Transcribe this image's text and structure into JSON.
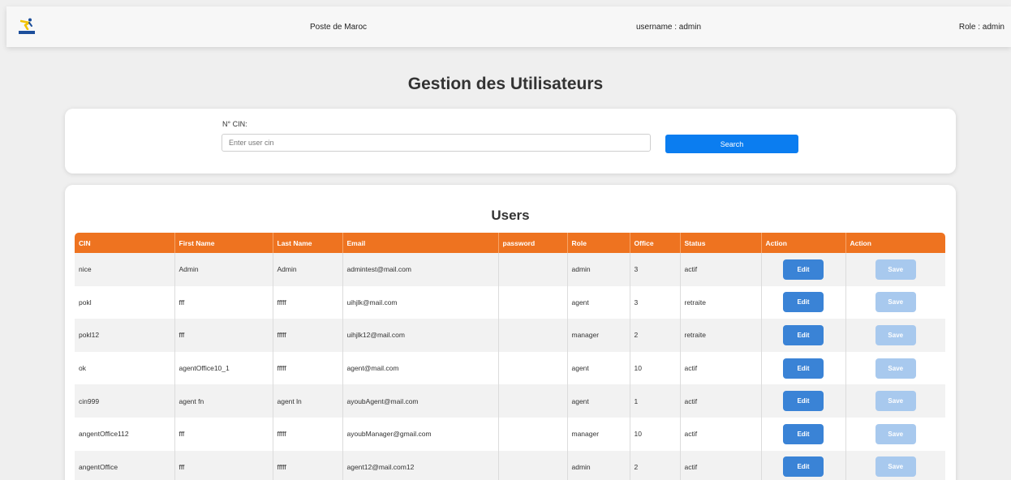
{
  "header": {
    "brand": "Poste de Maroc",
    "username": "username : admin",
    "role": "Role : admin"
  },
  "page": {
    "title": "Gestion des Utilisateurs"
  },
  "search": {
    "label": "N° CIN:",
    "placeholder": "Enter user cin",
    "value": "",
    "button_label": "Search"
  },
  "users": {
    "title": "Users",
    "columns": [
      "CIN",
      "First Name",
      "Last Name",
      "Email",
      "password",
      "Role",
      "Office",
      "Status",
      "Action",
      "Action"
    ],
    "edit_label": "Edit",
    "save_label": "Save",
    "rows": [
      {
        "cin": "nice",
        "first": "Admin",
        "last": "Admin",
        "email": "admintest@mail.com",
        "password": "",
        "role": "admin",
        "office": "3",
        "status": "actif"
      },
      {
        "cin": "pokl",
        "first": "fff",
        "last": "fffff",
        "email": "uihjlk@mail.com",
        "password": "",
        "role": "agent",
        "office": "3",
        "status": "retraite"
      },
      {
        "cin": "pokl12",
        "first": "fff",
        "last": "fffff",
        "email": "uihjlk12@mail.com",
        "password": "",
        "role": "manager",
        "office": "2",
        "status": "retraite"
      },
      {
        "cin": "ok",
        "first": "agentOffice10_1",
        "last": "fffff",
        "email": "agent@mail.com",
        "password": "",
        "role": "agent",
        "office": "10",
        "status": "actif"
      },
      {
        "cin": "cin999",
        "first": "agent fn",
        "last": "agent ln",
        "email": "ayoubAgent@mail.com",
        "password": "",
        "role": "agent",
        "office": "1",
        "status": "actif"
      },
      {
        "cin": "angentOffice112",
        "first": "fff",
        "last": "fffff",
        "email": "ayoubManager@gmail.com",
        "password": "",
        "role": "manager",
        "office": "10",
        "status": "actif"
      },
      {
        "cin": "angentOffice",
        "first": "fff",
        "last": "fffff",
        "email": "agent12@mail.com12",
        "password": "",
        "role": "admin",
        "office": "2",
        "status": "actif"
      }
    ]
  },
  "colors": {
    "accent": "#ee7320",
    "primary_button": "#0b7df0",
    "edit_button": "#3a83d6",
    "save_button_disabled": "#a8c9ee"
  },
  "icons": {
    "logo": "poste-maroc-logo"
  }
}
